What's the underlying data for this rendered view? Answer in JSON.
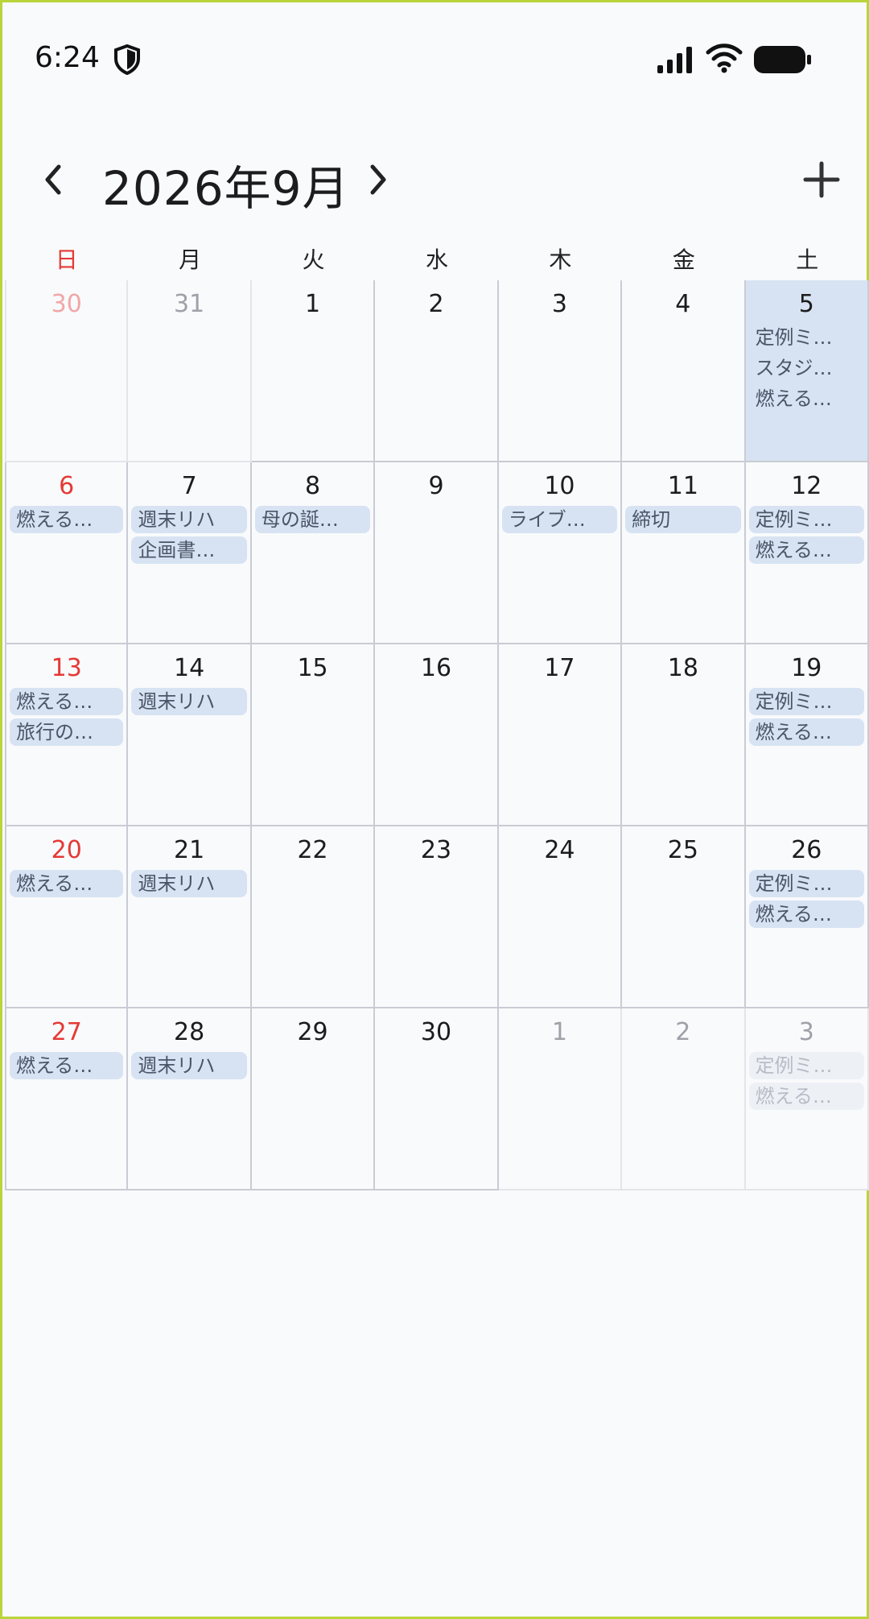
{
  "status_bar": {
    "time": "6:24"
  },
  "header": {
    "month_title": "2026年9月"
  },
  "weekdays": [
    "日",
    "月",
    "火",
    "水",
    "木",
    "金",
    "土"
  ],
  "weeks": [
    [
      {
        "day": "30",
        "muted": true,
        "events": []
      },
      {
        "day": "31",
        "muted": true,
        "events": []
      },
      {
        "day": "1",
        "events": []
      },
      {
        "day": "2",
        "events": []
      },
      {
        "day": "3",
        "events": []
      },
      {
        "day": "4",
        "events": []
      },
      {
        "day": "5",
        "selected": true,
        "events": [
          "定例ミ…",
          "スタジ…",
          "燃える…"
        ]
      }
    ],
    [
      {
        "day": "6",
        "events": [
          "燃える…"
        ]
      },
      {
        "day": "7",
        "events": [
          "週末リハ",
          "企画書…"
        ]
      },
      {
        "day": "8",
        "events": [
          "母の誕…"
        ]
      },
      {
        "day": "9",
        "events": []
      },
      {
        "day": "10",
        "events": [
          "ライブ…"
        ]
      },
      {
        "day": "11",
        "events": [
          "締切"
        ]
      },
      {
        "day": "12",
        "events": [
          "定例ミ…",
          "燃える…"
        ]
      }
    ],
    [
      {
        "day": "13",
        "events": [
          "燃える…",
          "旅行の…"
        ]
      },
      {
        "day": "14",
        "events": [
          "週末リハ"
        ]
      },
      {
        "day": "15",
        "events": []
      },
      {
        "day": "16",
        "events": []
      },
      {
        "day": "17",
        "events": []
      },
      {
        "day": "18",
        "events": []
      },
      {
        "day": "19",
        "events": [
          "定例ミ…",
          "燃える…"
        ]
      }
    ],
    [
      {
        "day": "20",
        "events": [
          "燃える…"
        ]
      },
      {
        "day": "21",
        "events": [
          "週末リハ"
        ]
      },
      {
        "day": "22",
        "events": []
      },
      {
        "day": "23",
        "events": []
      },
      {
        "day": "24",
        "events": []
      },
      {
        "day": "25",
        "events": []
      },
      {
        "day": "26",
        "events": [
          "定例ミ…",
          "燃える…"
        ]
      }
    ],
    [
      {
        "day": "27",
        "events": [
          "燃える…"
        ]
      },
      {
        "day": "28",
        "events": [
          "週末リハ"
        ]
      },
      {
        "day": "29",
        "events": []
      },
      {
        "day": "30",
        "events": []
      },
      {
        "day": "1",
        "muted": true,
        "events": []
      },
      {
        "day": "2",
        "muted": true,
        "events": []
      },
      {
        "day": "3",
        "muted": true,
        "events": [
          "定例ミ…",
          "燃える…"
        ]
      }
    ]
  ],
  "colors": {
    "sunday": "#e53935",
    "event_bg": "#d7e3f2",
    "selected_bg": "#d7e3f2",
    "grid_line": "#c9ccd4"
  }
}
